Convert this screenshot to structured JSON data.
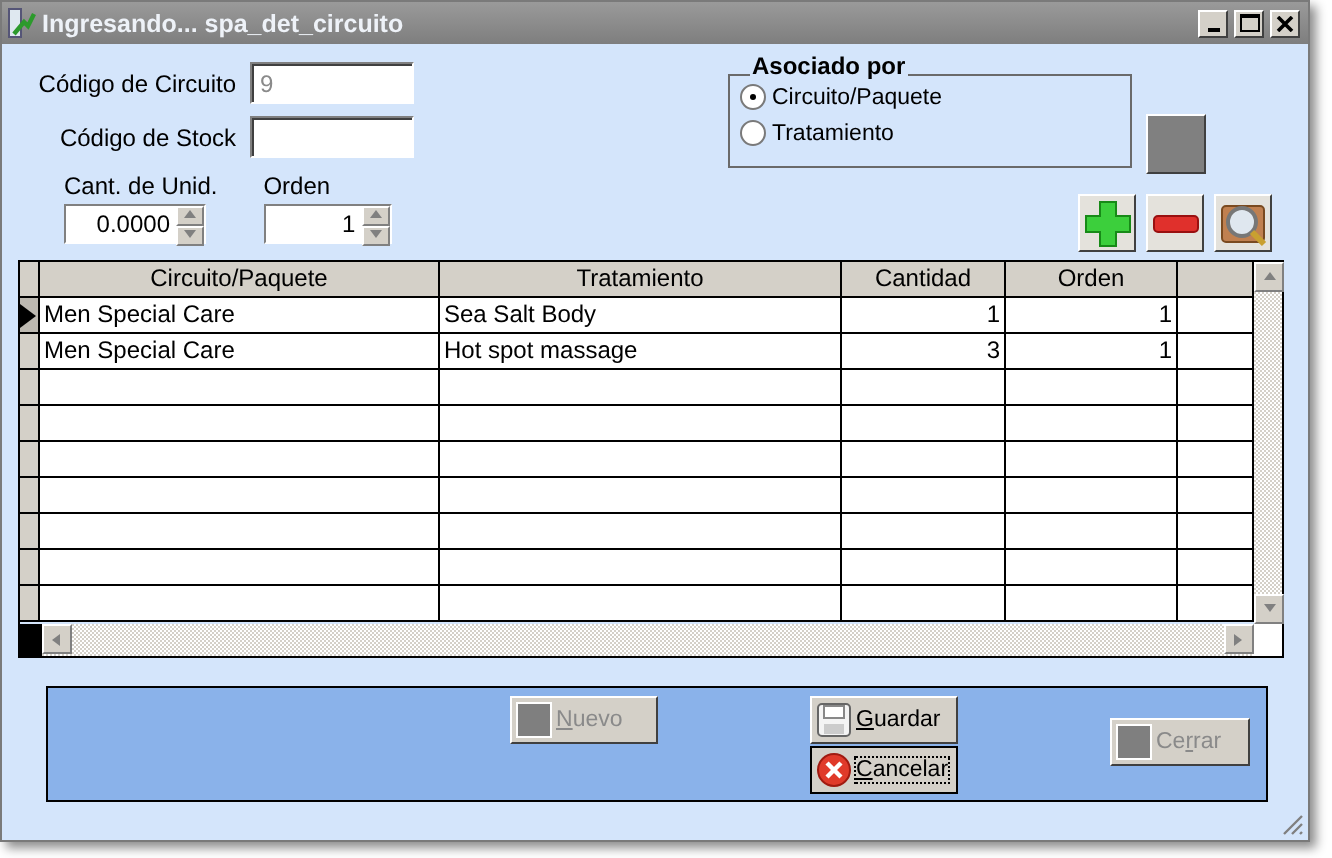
{
  "window": {
    "title": "Ingresando... spa_det_circuito"
  },
  "fields": [
    {
      "label": "Código de Circuito",
      "value": "9",
      "disabled": true
    },
    {
      "label": "Código de Stock"
    }
  ],
  "spinners": [
    {
      "label": "Cant. de Unid.",
      "value": "0.0000"
    },
    {
      "label": "Orden",
      "value": "1"
    }
  ],
  "group": {
    "title": "Asociado por",
    "options": [
      {
        "label": "Circuito/Paquete",
        "selected": true
      },
      {
        "label": "Tratamiento",
        "selected": false
      }
    ]
  },
  "table": {
    "columns": [
      "Circuito/Paquete",
      "Tratamiento",
      "Cantidad",
      "Orden"
    ],
    "rows": [
      {
        "cells": [
          "Men Special Care",
          "Sea Salt Body",
          "1",
          "1"
        ],
        "current": true
      },
      {
        "cells": [
          "Men Special Care",
          "Hot spot massage",
          "3",
          "1"
        ],
        "current": false
      }
    ]
  },
  "buttons": [
    {
      "kind": "plain",
      "label_parts": [
        {
          "text": "N",
          "underlined": true
        },
        {
          "text": "uevo",
          "underlined": false
        }
      ],
      "disabled": true,
      "focused": false
    },
    {
      "kind": "save",
      "label_parts": [
        {
          "text": "G",
          "underlined": true
        },
        {
          "text": "uardar",
          "underlined": false
        }
      ],
      "disabled": false,
      "focused": false
    },
    {
      "kind": "cancel",
      "label_parts": [
        {
          "text": "C",
          "underlined": true
        },
        {
          "text": "ancelar",
          "underlined": false
        }
      ],
      "disabled": false,
      "focused": true
    },
    {
      "kind": "plain",
      "label_parts": [
        {
          "text": "Ce",
          "underlined": false
        },
        {
          "text": "r",
          "underlined": true
        },
        {
          "text": "rar",
          "underlined": false
        }
      ],
      "disabled": true,
      "focused": false
    }
  ]
}
